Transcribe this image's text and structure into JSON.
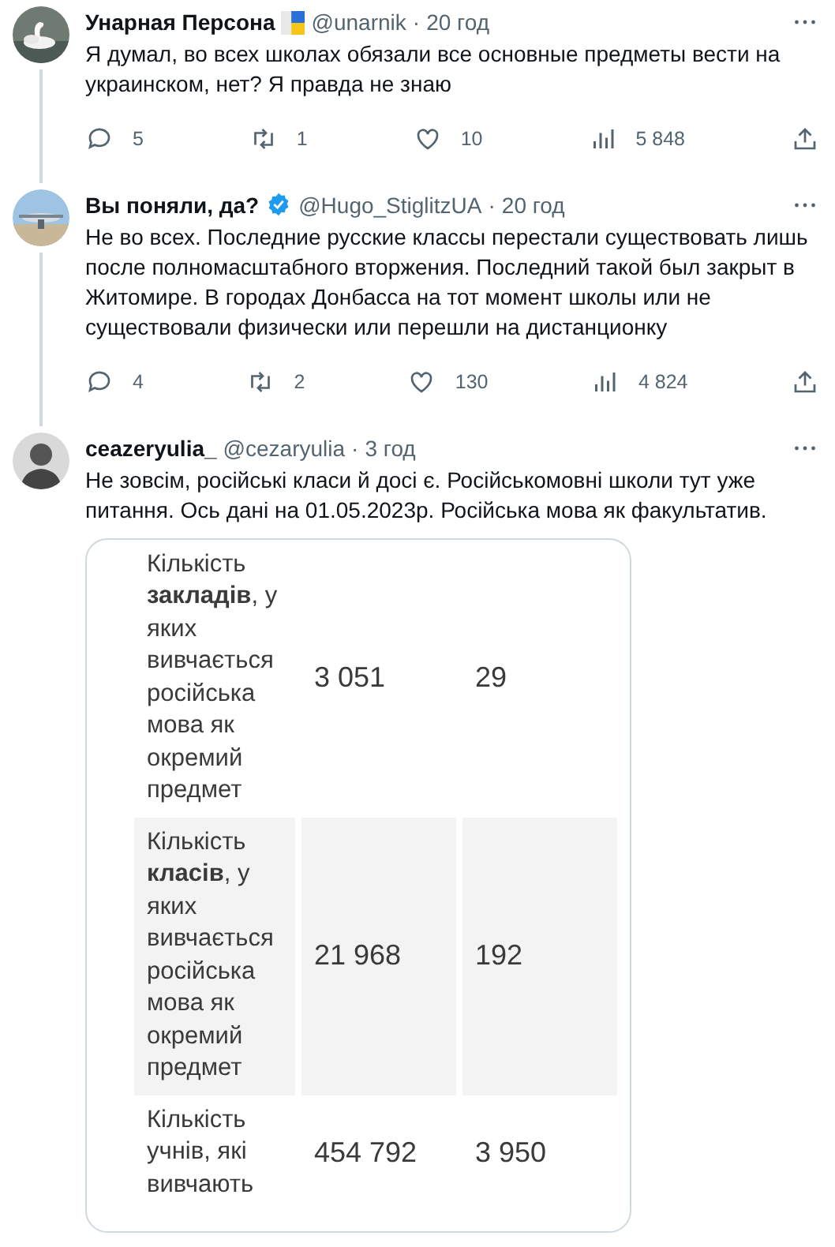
{
  "tweets": [
    {
      "name": "Унарная Персона",
      "badge": {
        "kind": "flag"
      },
      "handle": "@unarnik",
      "dot": "·",
      "time": "20 год",
      "text": "Я думал, во всех школах обязали все основные предметы вести на украинском, нет? Я правда не знаю",
      "thread_below": true,
      "stats": {
        "replies": "5",
        "retweets": "1",
        "likes": "10",
        "views": "5 848"
      }
    },
    {
      "name": "Вы поняли, да?",
      "badge": {
        "kind": "verified"
      },
      "handle": "@Hugo_StiglitzUA",
      "dot": "·",
      "time": "20 год",
      "text": "Не во всех. Последние русские классы перестали существовать лишь после полномасштабного вторжения. Последний такой был закрыт в Житомире. В городах Донбасса на тот момент школы или не существовали физически или перешли на дистанционку",
      "thread_below": true,
      "stats": {
        "replies": "4",
        "retweets": "2",
        "likes": "130",
        "views": "4 824"
      }
    },
    {
      "name": "ceazeryulia_",
      "handle": "@cezaryulia",
      "dot": "·",
      "time": "3 год",
      "text": "Не зовсім, російські класи й досі є. Російськомовні школи тут уже питання. Ось дані на 01.05.2023р. Російська мова як факультатив.",
      "thread_below": false,
      "attachment": {
        "rows": [
          {
            "label": "Кількість **закладів**, у яких вивчається російська мова як окремий предмет",
            "values": [
              "3 051",
              "29"
            ]
          },
          {
            "label": "Кількість **класів**, у яких вивчається російська мова як окремий предмет",
            "values": [
              "21 968",
              "192"
            ]
          },
          {
            "label": "Кількість учнів, які вивчають",
            "values": [
              "454 792",
              "3 950"
            ]
          }
        ]
      }
    }
  ]
}
